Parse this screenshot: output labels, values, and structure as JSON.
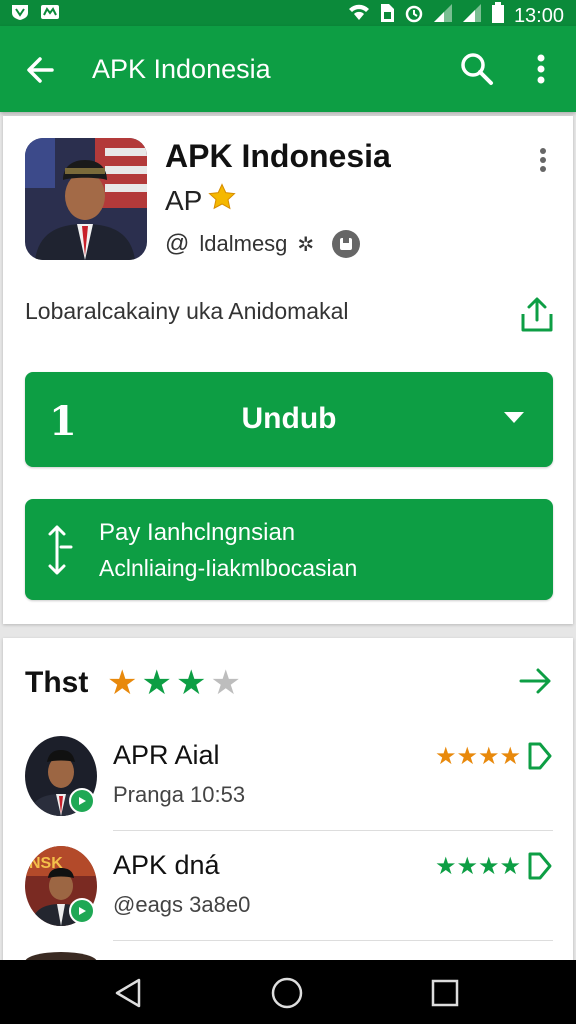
{
  "status_bar": {
    "time": "13:00"
  },
  "app_bar": {
    "title": "APK Indonesia"
  },
  "app": {
    "title": "APK Indonesia",
    "subtitle": "AP",
    "developer": "ldalmesg"
  },
  "description": "Lobaralcakainy uka  Anidomakal",
  "install_button": {
    "number": "1",
    "label": "Undub"
  },
  "secondary_button": {
    "line1": "Pay Ianhclngnsian",
    "line2": "Aclnliaing-Iiakmlbocasian"
  },
  "reviews": {
    "title": "Thst",
    "rating": 3,
    "max": 4,
    "items": [
      {
        "name": "APR Aial",
        "sub": "Pranga 10:53",
        "stars_color": "#e8890c"
      },
      {
        "name": "APK dná",
        "sub": "@eags 3a8e0",
        "stars_color": "#0d9e44"
      }
    ]
  },
  "colors": {
    "primary": "#0d9e44",
    "status_bar": "#0b8a3a",
    "star_orange": "#e8890c",
    "star_green": "#0d9e44",
    "star_empty": "#bdbdbd"
  }
}
